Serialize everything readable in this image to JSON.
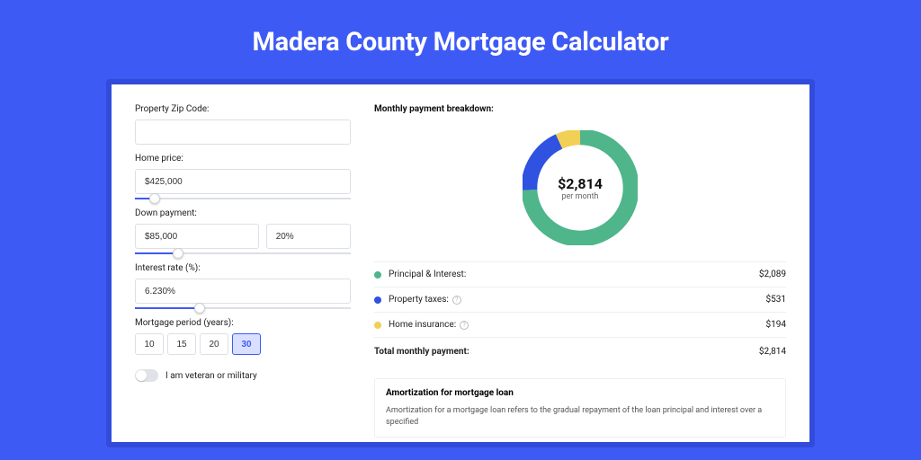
{
  "title": "Madera County Mortgage Calculator",
  "form": {
    "zip_label": "Property Zip Code:",
    "zip_value": "",
    "price_label": "Home price:",
    "price_value": "$425,000",
    "price_slider_pct": 9,
    "down_label": "Down payment:",
    "down_value": "$85,000",
    "down_pct_value": "20%",
    "down_slider_pct": 20,
    "rate_label": "Interest rate (%):",
    "rate_value": "6.230%",
    "rate_slider_pct": 30,
    "period_label": "Mortgage period (years):",
    "period_options": [
      "10",
      "15",
      "20",
      "30"
    ],
    "period_active": "30",
    "veteran_label": "I am veteran or military",
    "veteran_on": false
  },
  "breakdown": {
    "title": "Monthly payment breakdown:",
    "donut_amount": "$2,814",
    "donut_sub": "per month",
    "items": [
      {
        "label": "Principal & Interest:",
        "value": "$2,089",
        "color": "#4fb58a",
        "info": false
      },
      {
        "label": "Property taxes:",
        "value": "$531",
        "color": "#2f52e0",
        "info": true
      },
      {
        "label": "Home insurance:",
        "value": "$194",
        "color": "#f2cf55",
        "info": true
      }
    ],
    "total_label": "Total monthly payment:",
    "total_value": "$2,814"
  },
  "amortization": {
    "title": "Amortization for mortgage loan",
    "text": "Amortization for a mortgage loan refers to the gradual repayment of the loan principal and interest over a specified"
  },
  "chart_data": {
    "type": "pie",
    "title": "Monthly payment breakdown",
    "series": [
      {
        "name": "Principal & Interest",
        "value": 2089,
        "color": "#4fb58a"
      },
      {
        "name": "Property taxes",
        "value": 531,
        "color": "#2f52e0"
      },
      {
        "name": "Home insurance",
        "value": 194,
        "color": "#f2cf55"
      }
    ],
    "total": 2814,
    "center_label": "$2,814 per month"
  }
}
